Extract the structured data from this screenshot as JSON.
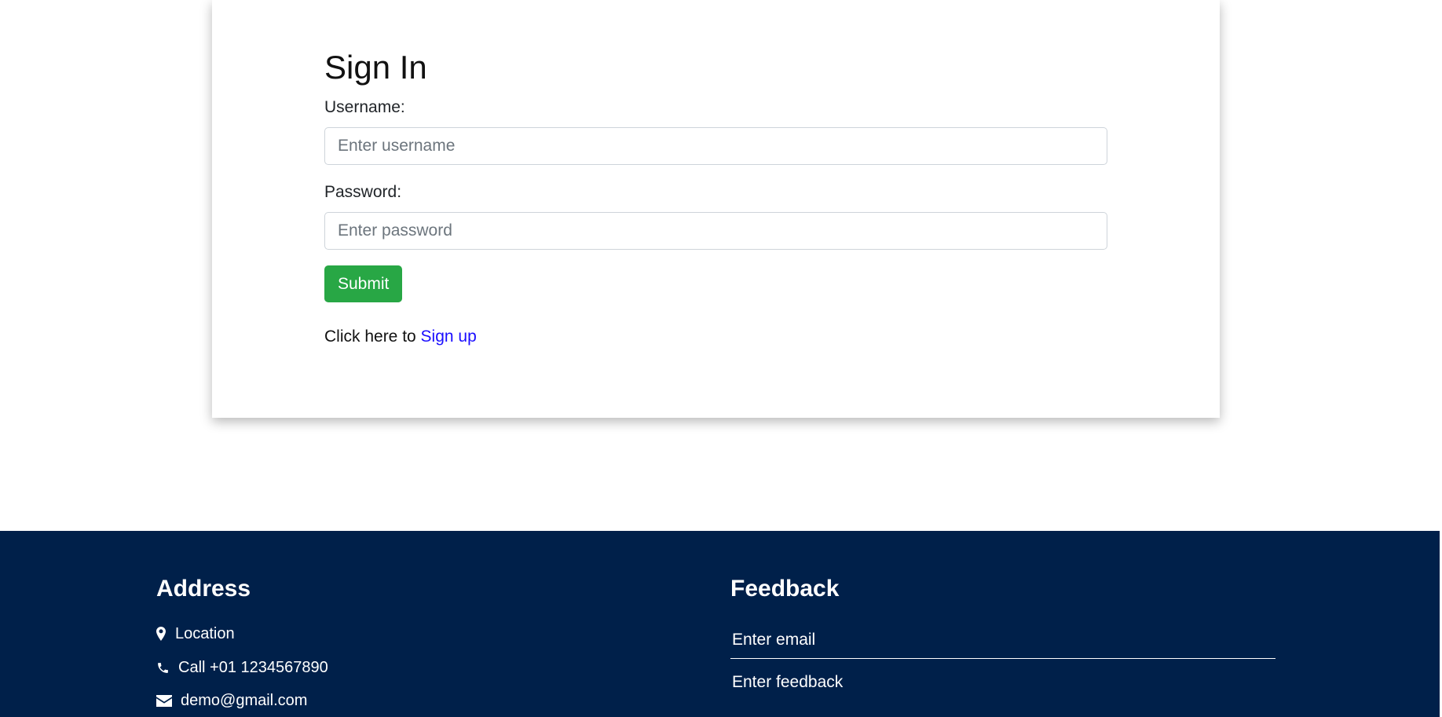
{
  "signin": {
    "title": "Sign In",
    "username_label": "Username:",
    "username_placeholder": "Enter username",
    "password_label": "Password:",
    "password_placeholder": "Enter password",
    "submit_label": "Submit",
    "signup_prefix": "Click here to ",
    "signup_link": "Sign up"
  },
  "footer": {
    "address": {
      "heading": "Address",
      "location": "Location",
      "phone": "Call +01 1234567890",
      "email": "demo@gmail.com",
      "icons": [
        "map-marker-icon",
        "phone-icon",
        "envelope-icon"
      ]
    },
    "feedback": {
      "heading": "Feedback",
      "email_placeholder": "Enter email",
      "feedback_placeholder": "Enter feedback"
    }
  },
  "colors": {
    "submit_green": "#28a745",
    "link_blue": "#1a0dff",
    "footer_navy": "#00204a"
  }
}
